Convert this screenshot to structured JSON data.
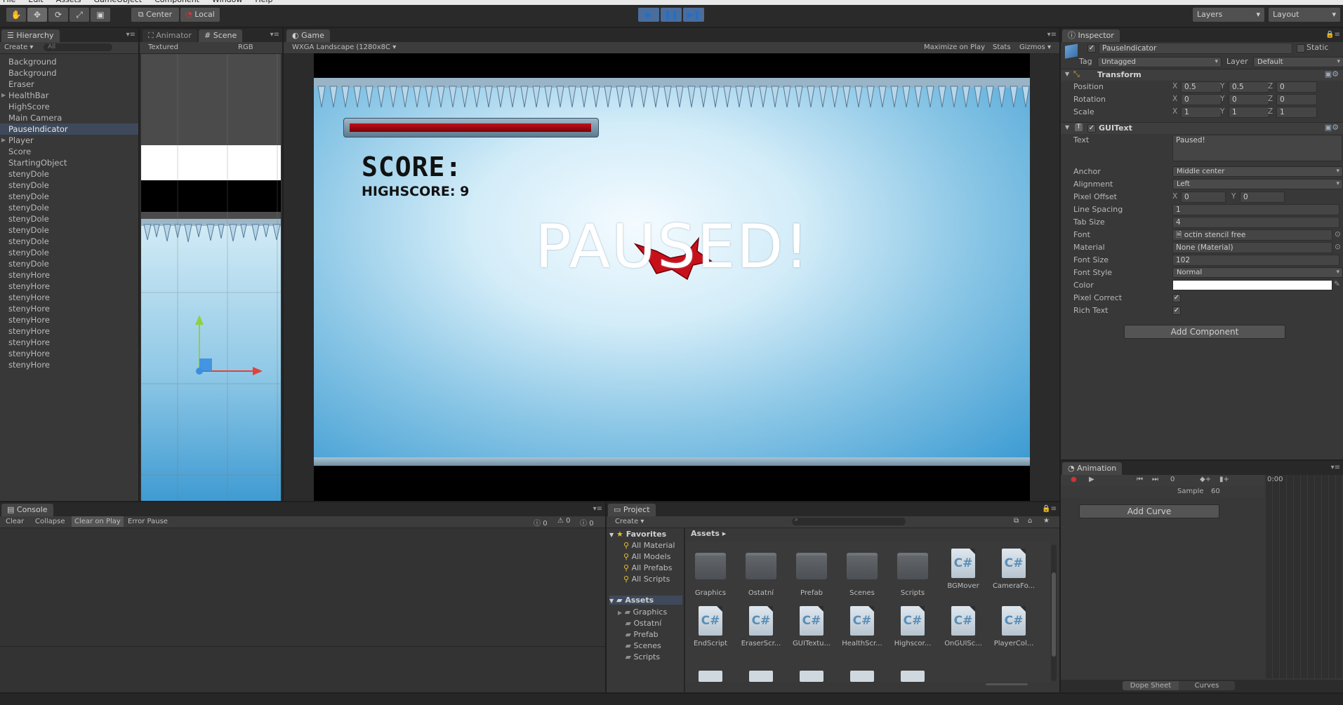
{
  "menubar": {
    "items": [
      "File",
      "Edit",
      "Assets",
      "GameObject",
      "Component",
      "Window",
      "Help"
    ]
  },
  "toolbar": {
    "pivot_label": "Center",
    "space_label": "Local",
    "layers_label": "Layers",
    "layout_label": "Layout"
  },
  "hierarchy": {
    "tab": "Hierarchy",
    "create_label": "Create",
    "search_placeholder": "All",
    "items": [
      {
        "label": "Background",
        "foldout": false,
        "selected": false
      },
      {
        "label": "Background",
        "foldout": false,
        "selected": false
      },
      {
        "label": "Eraser",
        "foldout": false,
        "selected": false
      },
      {
        "label": "HealthBar",
        "foldout": true,
        "selected": false
      },
      {
        "label": "HighScore",
        "foldout": false,
        "selected": false
      },
      {
        "label": "Main Camera",
        "foldout": false,
        "selected": false
      },
      {
        "label": "PauseIndicator",
        "foldout": false,
        "selected": true
      },
      {
        "label": "Player",
        "foldout": true,
        "selected": false
      },
      {
        "label": "Score",
        "foldout": false,
        "selected": false
      },
      {
        "label": "StartingObject",
        "foldout": false,
        "selected": false
      },
      {
        "label": "stenyDole",
        "foldout": false,
        "selected": false
      },
      {
        "label": "stenyDole",
        "foldout": false,
        "selected": false
      },
      {
        "label": "stenyDole",
        "foldout": false,
        "selected": false
      },
      {
        "label": "stenyDole",
        "foldout": false,
        "selected": false
      },
      {
        "label": "stenyDole",
        "foldout": false,
        "selected": false
      },
      {
        "label": "stenyDole",
        "foldout": false,
        "selected": false
      },
      {
        "label": "stenyDole",
        "foldout": false,
        "selected": false
      },
      {
        "label": "stenyDole",
        "foldout": false,
        "selected": false
      },
      {
        "label": "stenyDole",
        "foldout": false,
        "selected": false
      },
      {
        "label": "stenyHore",
        "foldout": false,
        "selected": false
      },
      {
        "label": "stenyHore",
        "foldout": false,
        "selected": false
      },
      {
        "label": "stenyHore",
        "foldout": false,
        "selected": false
      },
      {
        "label": "stenyHore",
        "foldout": false,
        "selected": false
      },
      {
        "label": "stenyHore",
        "foldout": false,
        "selected": false
      },
      {
        "label": "stenyHore",
        "foldout": false,
        "selected": false
      },
      {
        "label": "stenyHore",
        "foldout": false,
        "selected": false
      },
      {
        "label": "stenyHore",
        "foldout": false,
        "selected": false
      },
      {
        "label": "stenyHore",
        "foldout": false,
        "selected": false
      }
    ]
  },
  "scene": {
    "tab_animator": "Animator",
    "tab_scene": "Scene",
    "shading": "Textured",
    "render_mode": "RGB"
  },
  "game": {
    "tab": "Game",
    "aspect": "WXGA Landscape (1280x8C",
    "maximize_label": "Maximize on Play",
    "stats_label": "Stats",
    "gizmos_label": "Gizmos",
    "score_label": "SCORE:",
    "highscore_label": "HIGHSCORE: 9",
    "paused_label": "PAUSED!",
    "health_fraction": 1.0
  },
  "inspector": {
    "tab": "Inspector",
    "object_name": "PauseIndicator",
    "static_label": "Static",
    "tag_label": "Tag",
    "tag_value": "Untagged",
    "layer_label": "Layer",
    "layer_value": "Default",
    "transform": {
      "title": "Transform",
      "position_label": "Position",
      "rotation_label": "Rotation",
      "scale_label": "Scale",
      "position": {
        "x": "0.5",
        "y": "0.5",
        "z": "0"
      },
      "rotation": {
        "x": "0",
        "y": "0",
        "z": "0"
      },
      "scale": {
        "x": "1",
        "y": "1",
        "z": "1"
      }
    },
    "guitext": {
      "title": "GUIText",
      "text_label": "Text",
      "text_value": "Paused!",
      "anchor_label": "Anchor",
      "anchor_value": "Middle center",
      "alignment_label": "Alignment",
      "alignment_value": "Left",
      "pixel_offset_label": "Pixel Offset",
      "pixel_offset": {
        "x": "0",
        "y": "0"
      },
      "line_spacing_label": "Line Spacing",
      "line_spacing_value": "1",
      "tab_size_label": "Tab Size",
      "tab_size_value": "4",
      "font_label": "Font",
      "font_value": "octin stencil free",
      "material_label": "Material",
      "material_value": "None (Material)",
      "font_size_label": "Font Size",
      "font_size_value": "102",
      "font_style_label": "Font Style",
      "font_style_value": "Normal",
      "color_label": "Color",
      "color_value": "#ffffff",
      "pixel_correct_label": "Pixel Correct",
      "pixel_correct": true,
      "rich_text_label": "Rich Text",
      "rich_text": true
    },
    "add_component_label": "Add Component"
  },
  "animation": {
    "tab": "Animation",
    "frame_value": "0",
    "time_label": "0:00",
    "sample_label": "Sample",
    "sample_value": "60",
    "add_curve_label": "Add Curve",
    "dope_sheet_label": "Dope Sheet",
    "curves_label": "Curves"
  },
  "console": {
    "tab": "Console",
    "clear_label": "Clear",
    "collapse_label": "Collapse",
    "clear_on_play_label": "Clear on Play",
    "error_pause_label": "Error Pause",
    "info_count": "0",
    "warning_count": "0",
    "error_count": "0"
  },
  "project": {
    "tab": "Project",
    "create_label": "Create",
    "favorites_label": "Favorites",
    "favorites": [
      "All Material",
      "All Models",
      "All Prefabs",
      "All Scripts"
    ],
    "assets_label": "Assets",
    "asset_folders": [
      "Graphics",
      "Ostatní",
      "Prefab",
      "Scenes",
      "Scripts"
    ],
    "breadcrumb": "Assets",
    "grid_row1": [
      {
        "label": "Graphics",
        "kind": "folder"
      },
      {
        "label": "Ostatní",
        "kind": "folder"
      },
      {
        "label": "Prefab",
        "kind": "folder"
      },
      {
        "label": "Scenes",
        "kind": "folder"
      },
      {
        "label": "Scripts",
        "kind": "folder"
      },
      {
        "label": "BGMover",
        "kind": "script"
      },
      {
        "label": "CameraFo...",
        "kind": "script"
      }
    ],
    "grid_row2": [
      {
        "label": "EndScript",
        "kind": "script"
      },
      {
        "label": "EraserScr...",
        "kind": "script"
      },
      {
        "label": "GUITextu...",
        "kind": "script"
      },
      {
        "label": "HealthScr...",
        "kind": "script"
      },
      {
        "label": "Highscor...",
        "kind": "script"
      },
      {
        "label": "OnGUISc...",
        "kind": "script"
      },
      {
        "label": "PlayerCol...",
        "kind": "script"
      }
    ]
  }
}
